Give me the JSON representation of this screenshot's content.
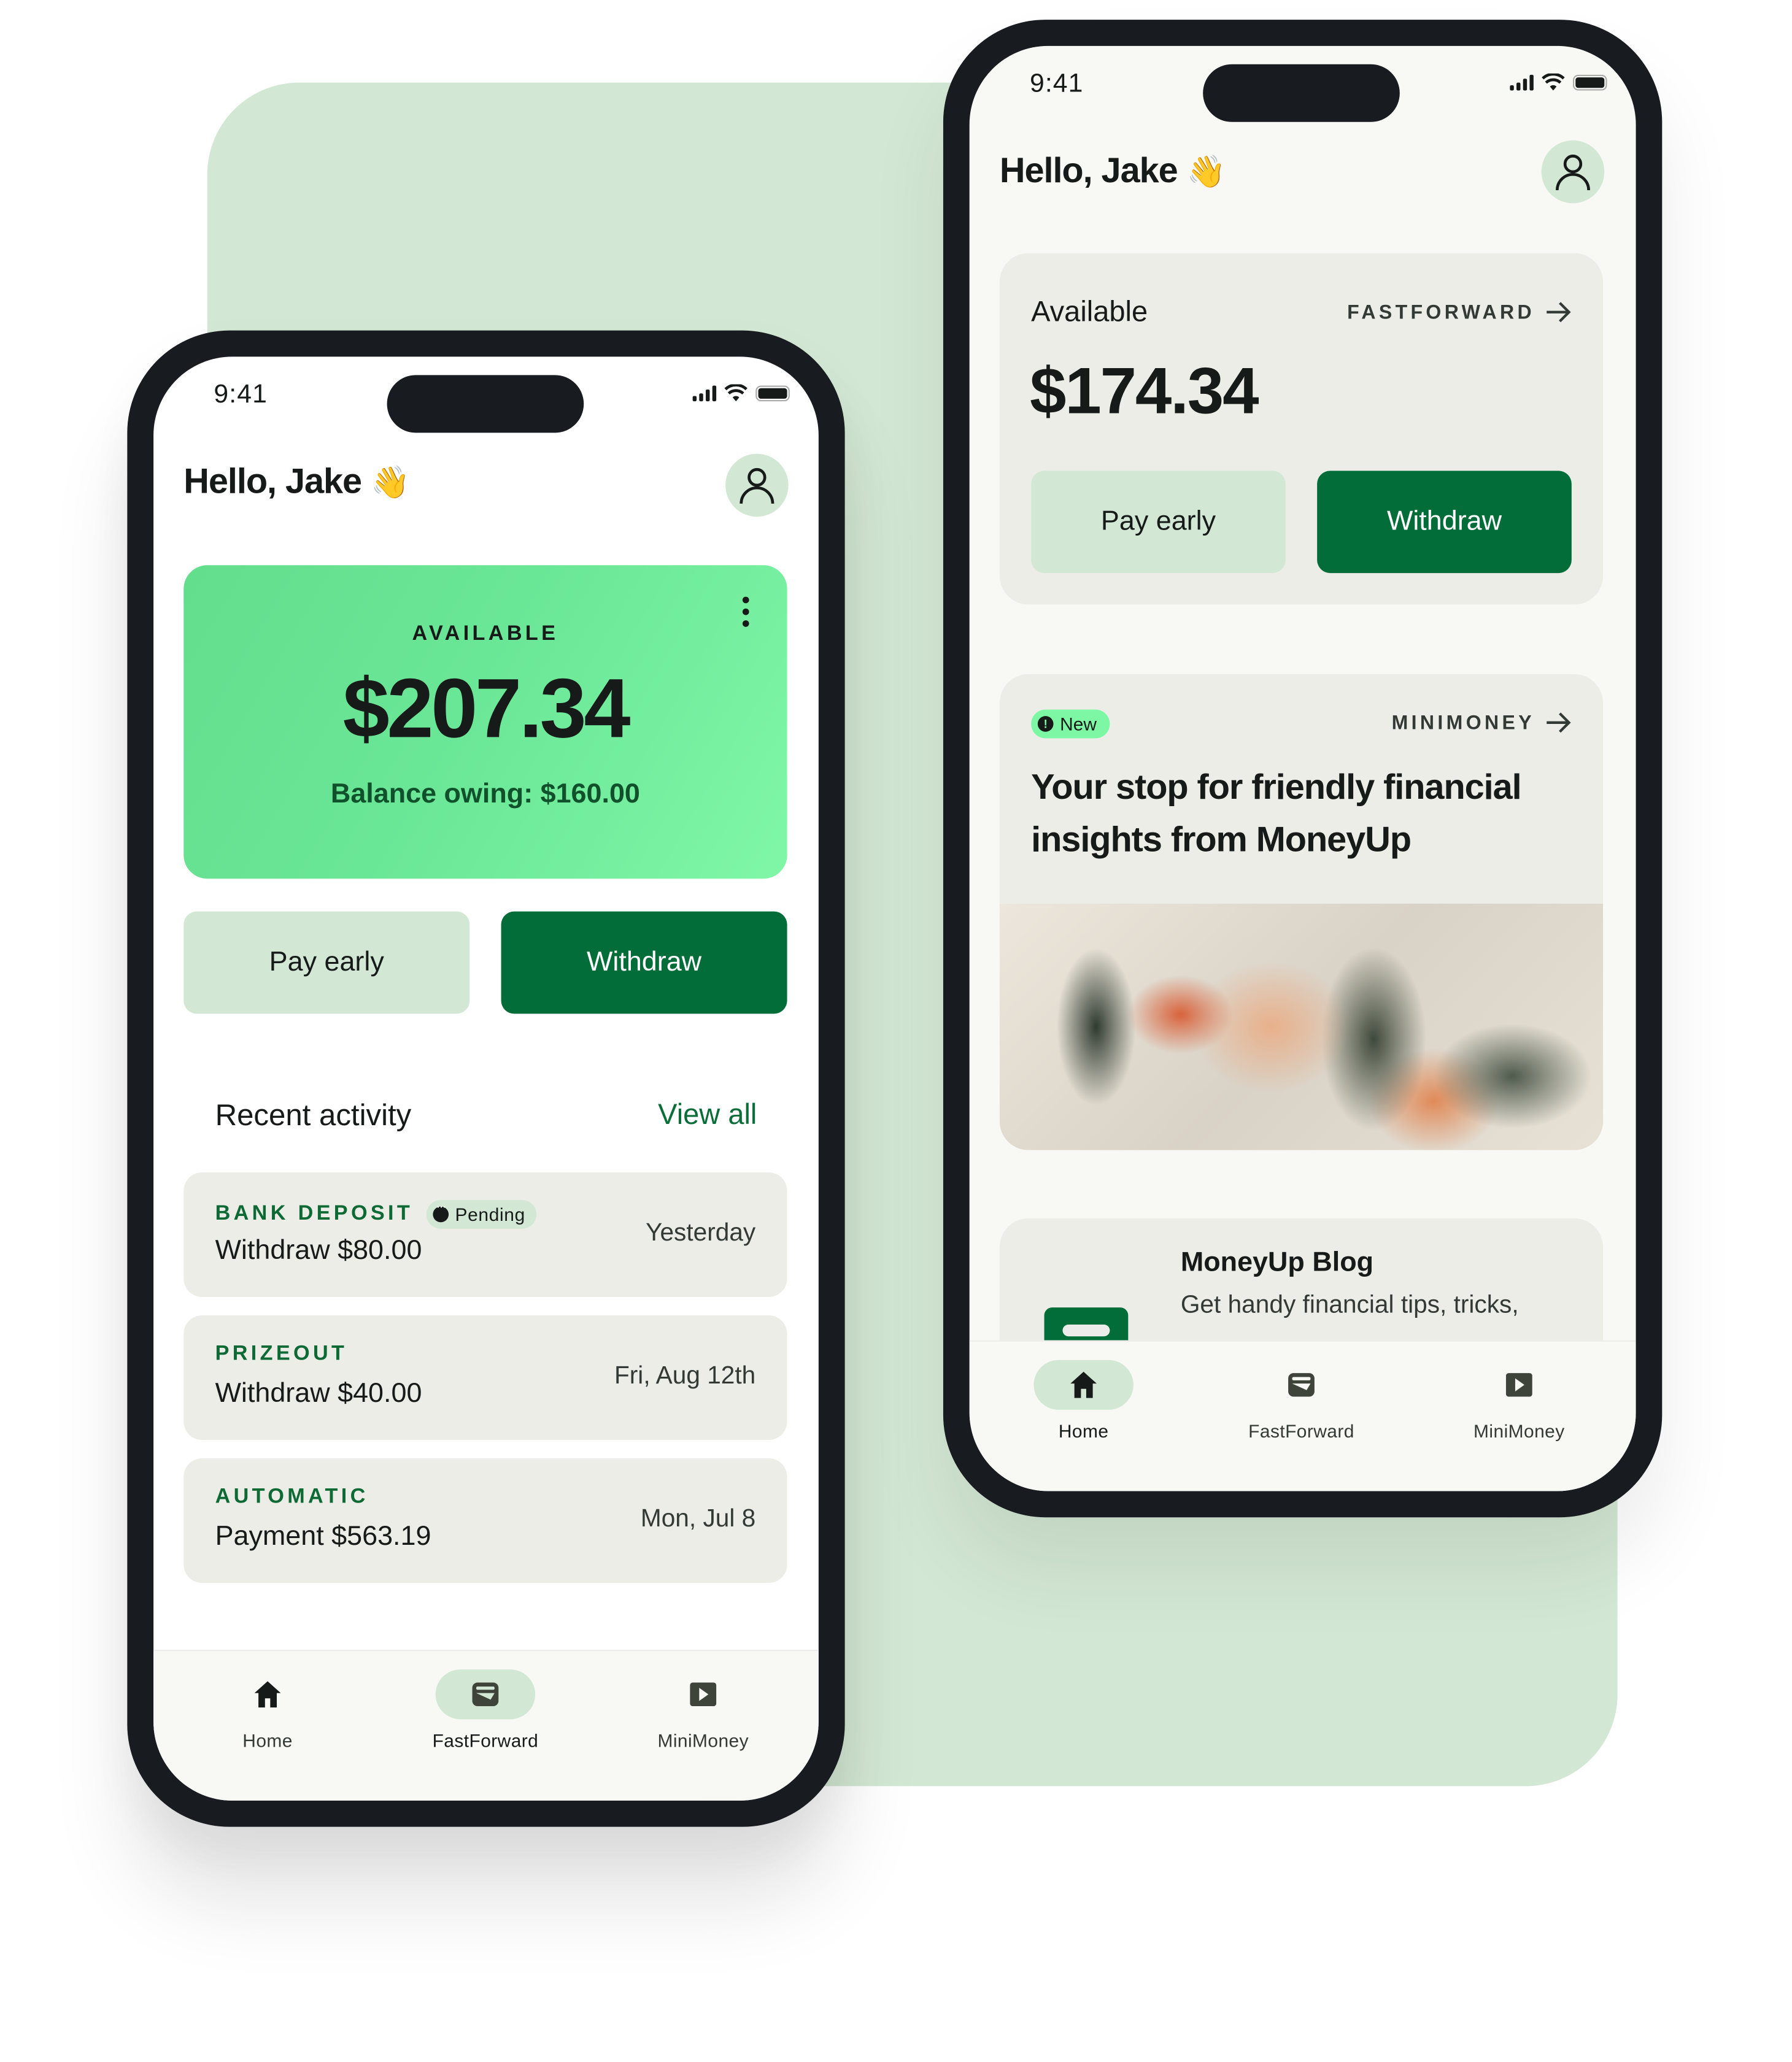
{
  "colors": {
    "background_card": "#d3e8d4",
    "brand_dark_green": "#026d38",
    "light_green": "#d3e8d4",
    "hero_gradient_start": "#62de8c",
    "hero_gradient_end": "#7ff7a6",
    "activity_card": "#edede8",
    "phone_frame": "#181b20"
  },
  "left_phone": {
    "status_bar": {
      "time": "9:41"
    },
    "greeting": "Hello, Jake",
    "greeting_emoji": "👋",
    "hero": {
      "label": "AVAILABLE",
      "amount": "$207.34",
      "balance_owing": "Balance owing: $160.00",
      "menu_icon": "more-vertical-icon"
    },
    "buttons": {
      "pay_early": "Pay early",
      "withdraw": "Withdraw"
    },
    "recent_activity": {
      "title": "Recent activity",
      "view_all": "View all",
      "items": [
        {
          "category": "BANK DEPOSIT",
          "badge": "Pending",
          "description": "Withdraw $80.00",
          "date": "Yesterday"
        },
        {
          "category": "PRIZEOUT",
          "description": "Withdraw $40.00",
          "date": "Fri, Aug 12th"
        },
        {
          "category": "AUTOMATIC",
          "description": "Payment $563.19",
          "date": "Mon, Jul 8"
        }
      ]
    },
    "tabbar": {
      "active": "FastForward",
      "tabs": [
        {
          "label": "Home",
          "icon": "home-icon"
        },
        {
          "label": "FastForward",
          "icon": "wallet-icon"
        },
        {
          "label": "MiniMoney",
          "icon": "play-icon"
        }
      ]
    }
  },
  "right_phone": {
    "status_bar": {
      "time": "9:41"
    },
    "greeting": "Hello, Jake",
    "greeting_emoji": "👋",
    "balance_card": {
      "label": "Available",
      "link": "FASTFORWARD",
      "amount": "$174.34",
      "pay_early": "Pay early",
      "withdraw": "Withdraw"
    },
    "promo_card": {
      "badge": "New",
      "link": "MINIMONEY",
      "title": "Your stop for friendly financial insights from MoneyUp",
      "image_alt": "Groceries on a white blanket"
    },
    "blog_card": {
      "title": "MoneyUp Blog",
      "text": "Get handy financial tips, tricks,"
    },
    "tabbar": {
      "active": "Home",
      "tabs": [
        {
          "label": "Home",
          "icon": "home-icon"
        },
        {
          "label": "FastForward",
          "icon": "wallet-icon"
        },
        {
          "label": "MiniMoney",
          "icon": "play-icon"
        }
      ]
    }
  }
}
